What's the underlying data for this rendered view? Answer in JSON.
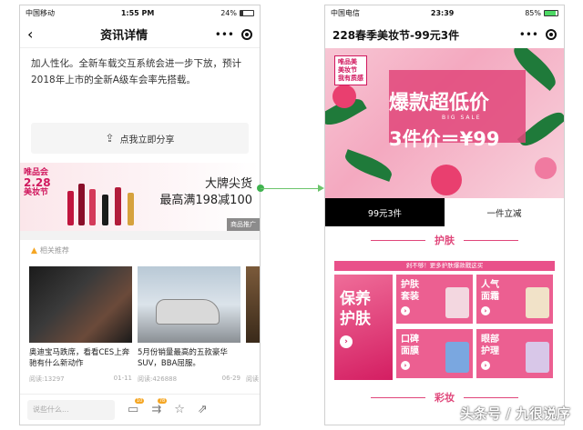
{
  "left_phone": {
    "status": {
      "carrier": "中国移动",
      "time": "1:55 PM",
      "battery": "24%"
    },
    "nav": {
      "back_icon": "back-arrow-icon",
      "title": "资讯详情",
      "more": "•••"
    },
    "article_text": "加人性化。全新车载交互系统会进一步下放，预计2018年上市的全新A级车会率先搭载。",
    "share_label": "点我立即分享",
    "ad": {
      "badge_top": "唯品会",
      "badge_big": "2.28",
      "badge_sub": "美妆节",
      "line1": "大牌尖货",
      "line2": "最高满198减100",
      "tag": "商品推广"
    },
    "recommend_title": "相关推荐",
    "cards": [
      {
        "title": "奥迪宝马跌席，看看CES上奔驰有什么新动作",
        "reads": "阅读:13297",
        "date": "01-11"
      },
      {
        "title": "5月份销量最高的五款豪华SUV，BBA屈服。",
        "reads": "阅读:426888",
        "date": "06-29"
      },
      {
        "title": "",
        "reads": "阅读",
        "date": ""
      }
    ],
    "bottom": {
      "comment_placeholder": "说些什么...",
      "comment_count": "10",
      "share_count": "78"
    }
  },
  "right_phone": {
    "status": {
      "carrier": "中国电信",
      "time": "23:39",
      "battery": "85%"
    },
    "nav": {
      "title": "228春季美妆节-99元3件",
      "more": "•••"
    },
    "banner": {
      "tag_line1": "唯品美",
      "tag_line2": "美妆节",
      "tag_line3": "我有质感",
      "headline_prefix": "爆款",
      "headline_main": "超低价",
      "subline": "BIG SALE",
      "price": "3件价＝¥99"
    },
    "tabs": [
      {
        "label": "99元3件",
        "active": true
      },
      {
        "label": "一件立减",
        "active": false
      }
    ],
    "section1": "护肤",
    "promo_bar": "剁不够！更多护肤爆款戳这买",
    "big_tile": {
      "line1": "保养",
      "line2": "护肤"
    },
    "tiles": [
      {
        "line1": "护肤",
        "line2": "套装"
      },
      {
        "line1": "人气",
        "line2": "面霜"
      },
      {
        "line1": "口碑",
        "line2": "面膜"
      },
      {
        "line1": "眼部",
        "line2": "护理"
      }
    ],
    "section2": "彩妆"
  },
  "watermark": "头条号 / 九很说序",
  "colors": {
    "brand_pink": "#e0467a",
    "tile_pink": "#ec5f91",
    "connector_green": "#6cc46c"
  }
}
